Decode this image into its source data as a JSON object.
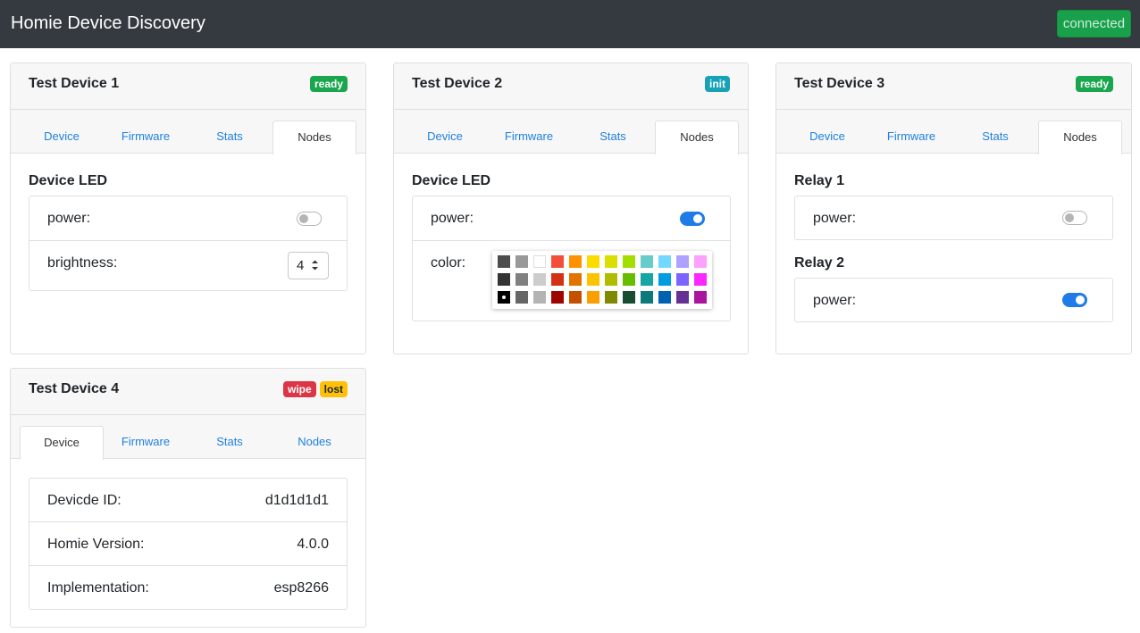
{
  "app": {
    "title": "Homie Device Discovery",
    "connection_status": "connected"
  },
  "tab_labels": [
    "Device",
    "Firmware",
    "Stats",
    "Nodes"
  ],
  "devices": [
    {
      "name": "Test Device 1",
      "badges": [
        "ready"
      ],
      "active_tab": "Nodes",
      "nodes": [
        {
          "title": "Device LED",
          "properties": [
            {
              "label": "power:",
              "type": "switch",
              "value": false
            },
            {
              "label": "brightness:",
              "type": "stepper",
              "value": "4"
            }
          ]
        }
      ]
    },
    {
      "name": "Test Device 2",
      "badges": [
        "init"
      ],
      "active_tab": "Nodes",
      "nodes": [
        {
          "title": "Device LED",
          "properties": [
            {
              "label": "power:",
              "type": "switch",
              "value": true
            },
            {
              "label": "color:",
              "type": "color",
              "value": "#000000"
            }
          ]
        }
      ]
    },
    {
      "name": "Test Device 3",
      "badges": [
        "ready"
      ],
      "active_tab": "Nodes",
      "nodes": [
        {
          "title": "Relay 1",
          "properties": [
            {
              "label": "power:",
              "type": "switch",
              "value": false
            }
          ]
        },
        {
          "title": "Relay 2",
          "properties": [
            {
              "label": "power:",
              "type": "switch",
              "value": true
            }
          ]
        }
      ]
    },
    {
      "name": "Test Device 4",
      "badges": [
        "wipe",
        "lost"
      ],
      "active_tab": "Device",
      "info": [
        {
          "label": "Devicde ID:",
          "value": "d1d1d1d1"
        },
        {
          "label": "Homie Version:",
          "value": "4.0.0"
        },
        {
          "label": "Implementation:",
          "value": "esp8266"
        }
      ]
    }
  ],
  "color_palette": {
    "rows": [
      [
        "#4d4d4d",
        "#999999",
        "#ffffff",
        "#f44e3b",
        "#fe9200",
        "#fcdc00",
        "#dbdf00",
        "#a4dd00",
        "#68ccca",
        "#73d8ff",
        "#aea1ff",
        "#fda1ff"
      ],
      [
        "#333333",
        "#808080",
        "#cccccc",
        "#d33115",
        "#e27300",
        "#fcc400",
        "#b0bc00",
        "#68bc00",
        "#16a5a5",
        "#009ce0",
        "#7b64ff",
        "#fa28ff"
      ],
      [
        "#000000",
        "#666666",
        "#b3b3b3",
        "#9f0500",
        "#c45100",
        "#fb9e00",
        "#808900",
        "#194d33",
        "#0c797d",
        "#0062b1",
        "#653294",
        "#ab149e"
      ]
    ],
    "selected": "#000000"
  },
  "colors": {
    "navbar": "#343a40",
    "connected": "#18a04a",
    "link": "#1e80e0",
    "toggle_on": "#1f7be8"
  }
}
